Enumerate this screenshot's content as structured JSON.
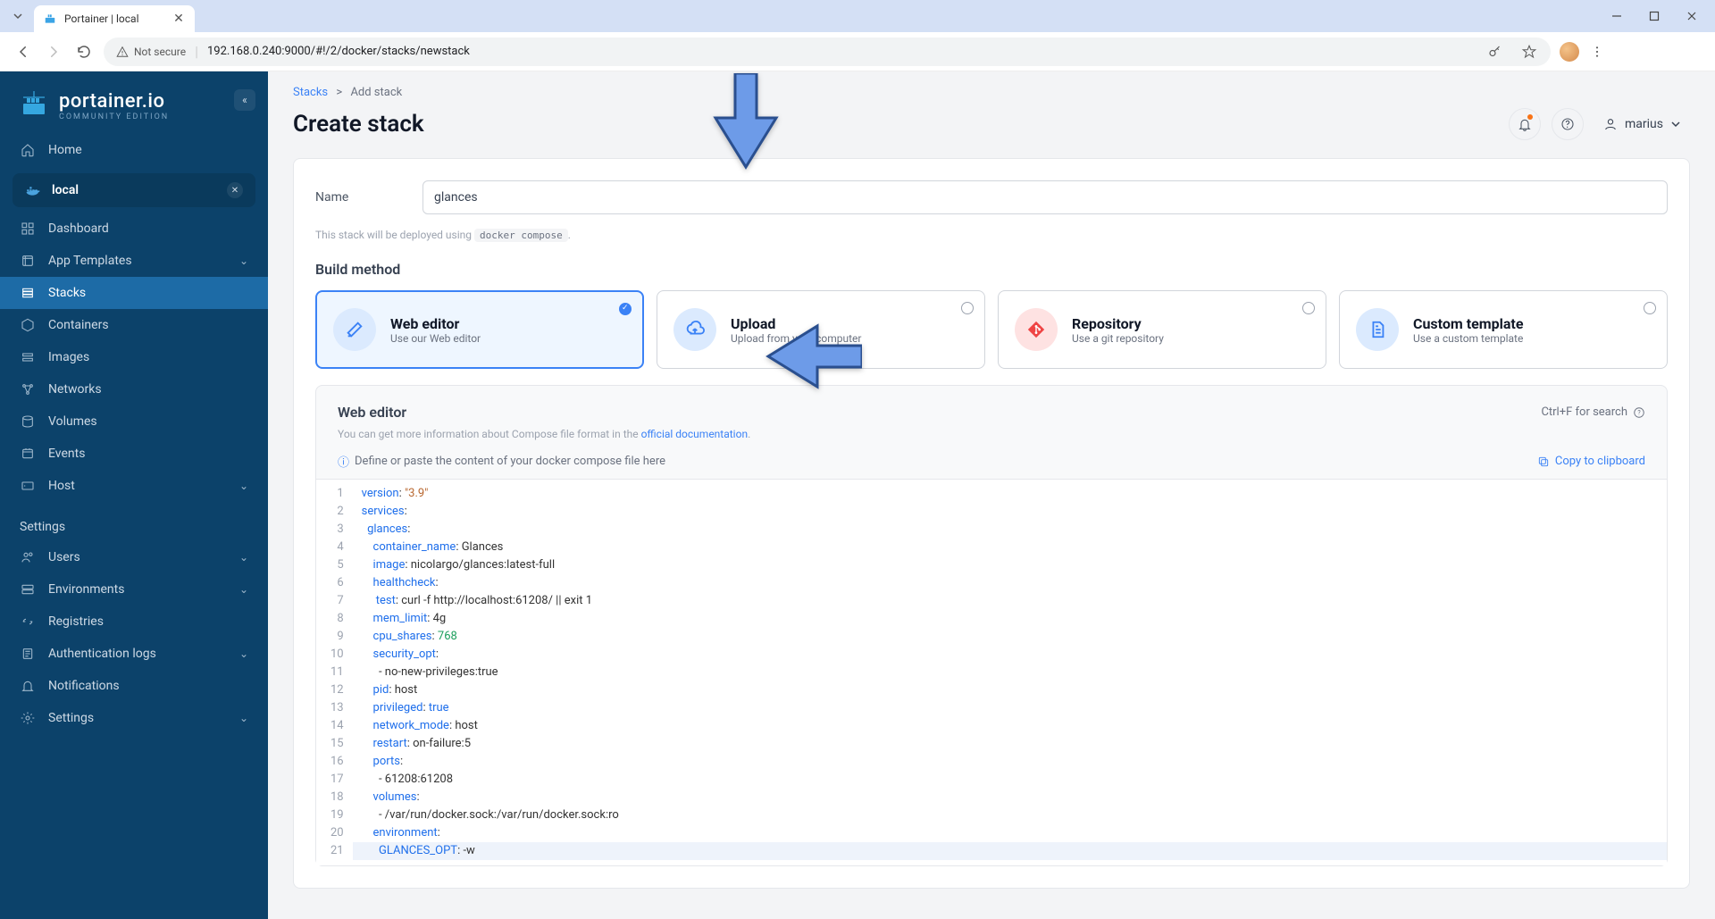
{
  "browser": {
    "tab_title": "Portainer | local",
    "not_secure": "Not secure",
    "url": "192.168.0.240:9000/#!/2/docker/stacks/newstack"
  },
  "sidebar": {
    "brand": "portainer.io",
    "brand_sub": "COMMUNITY EDITION",
    "home": "Home",
    "env_name": "local",
    "items": [
      {
        "label": "Dashboard"
      },
      {
        "label": "App Templates"
      },
      {
        "label": "Stacks"
      },
      {
        "label": "Containers"
      },
      {
        "label": "Images"
      },
      {
        "label": "Networks"
      },
      {
        "label": "Volumes"
      },
      {
        "label": "Events"
      },
      {
        "label": "Host"
      }
    ],
    "settings_header": "Settings",
    "settings": [
      {
        "label": "Users"
      },
      {
        "label": "Environments"
      },
      {
        "label": "Registries"
      },
      {
        "label": "Authentication logs"
      },
      {
        "label": "Notifications"
      },
      {
        "label": "Settings"
      }
    ]
  },
  "header": {
    "breadcrumb_root": "Stacks",
    "breadcrumb_sep": ">",
    "breadcrumb_leaf": "Add stack",
    "title": "Create stack",
    "user": "marius"
  },
  "form": {
    "name_label": "Name",
    "name_value": "glances",
    "deploy_help_prefix": "This stack will be deployed using ",
    "deploy_help_code": "docker compose",
    "deploy_help_suffix": ".",
    "build_method_title": "Build method",
    "methods": [
      {
        "title": "Web editor",
        "sub": "Use our Web editor"
      },
      {
        "title": "Upload",
        "sub": "Upload from your computer"
      },
      {
        "title": "Repository",
        "sub": "Use a git repository"
      },
      {
        "title": "Custom template",
        "sub": "Use a custom template"
      }
    ]
  },
  "editor": {
    "title": "Web editor",
    "search_hint": "Ctrl+F for search",
    "desc_prefix": "You can get more information about Compose file format in the ",
    "desc_link": "official documentation",
    "desc_suffix": ".",
    "placeholder": "Define or paste the content of your docker compose file here",
    "copy": "Copy to clipboard",
    "code": {
      "lines": [
        {
          "n": 1,
          "html": "<span class='c-key'>version</span><span class='c-col'>:</span> <span class='c-str'>\"3.9\"</span>"
        },
        {
          "n": 2,
          "html": "<span class='c-key'>services</span><span class='c-col'>:</span>"
        },
        {
          "n": 3,
          "html": "  <span class='c-key'>glances</span><span class='c-col'>:</span>"
        },
        {
          "n": 4,
          "html": "    <span class='c-key'>container_name</span><span class='c-col'>:</span> <span class='c-pl'>Glances</span>"
        },
        {
          "n": 5,
          "html": "    <span class='c-key'>image</span><span class='c-col'>:</span> <span class='c-pl'>nicolargo/glances:latest-full</span>"
        },
        {
          "n": 6,
          "html": "    <span class='c-key'>healthcheck</span><span class='c-col'>:</span>"
        },
        {
          "n": 7,
          "html": "     <span class='c-key'>test</span><span class='c-col'>:</span> <span class='c-pl'>curl -f http://localhost:61208/ || exit 1</span>"
        },
        {
          "n": 8,
          "html": "    <span class='c-key'>mem_limit</span><span class='c-col'>:</span> <span class='c-pl'>4g</span>"
        },
        {
          "n": 9,
          "html": "    <span class='c-key'>cpu_shares</span><span class='c-col'>:</span> <span class='c-num'>768</span>"
        },
        {
          "n": 10,
          "html": "    <span class='c-key'>security_opt</span><span class='c-col'>:</span>"
        },
        {
          "n": 11,
          "html": "      <span class='c-pl'>- no-new-privileges:true</span>"
        },
        {
          "n": 12,
          "html": "    <span class='c-key'>pid</span><span class='c-col'>:</span> <span class='c-pl'>host</span>"
        },
        {
          "n": 13,
          "html": "    <span class='c-key'>privileged</span><span class='c-col'>:</span> <span class='c-lit'>true</span>"
        },
        {
          "n": 14,
          "html": "    <span class='c-key'>network_mode</span><span class='c-col'>:</span> <span class='c-pl'>host</span>"
        },
        {
          "n": 15,
          "html": "    <span class='c-key'>restart</span><span class='c-col'>:</span> <span class='c-pl'>on-failure:5</span>"
        },
        {
          "n": 16,
          "html": "    <span class='c-key'>ports</span><span class='c-col'>:</span>"
        },
        {
          "n": 17,
          "html": "      <span class='c-pl'>- 61208:61208</span>"
        },
        {
          "n": 18,
          "html": "    <span class='c-key'>volumes</span><span class='c-col'>:</span>"
        },
        {
          "n": 19,
          "html": "      <span class='c-pl'>- /var/run/docker.sock:/var/run/docker.sock:ro</span>"
        },
        {
          "n": 20,
          "html": "    <span class='c-key'>environment</span><span class='c-col'>:</span>"
        },
        {
          "n": 21,
          "html": "      <span class='c-key'>GLANCES_OPT</span><span class='c-col'>:</span> <span class='c-pl'>-w</span>",
          "hl": true
        }
      ]
    }
  }
}
